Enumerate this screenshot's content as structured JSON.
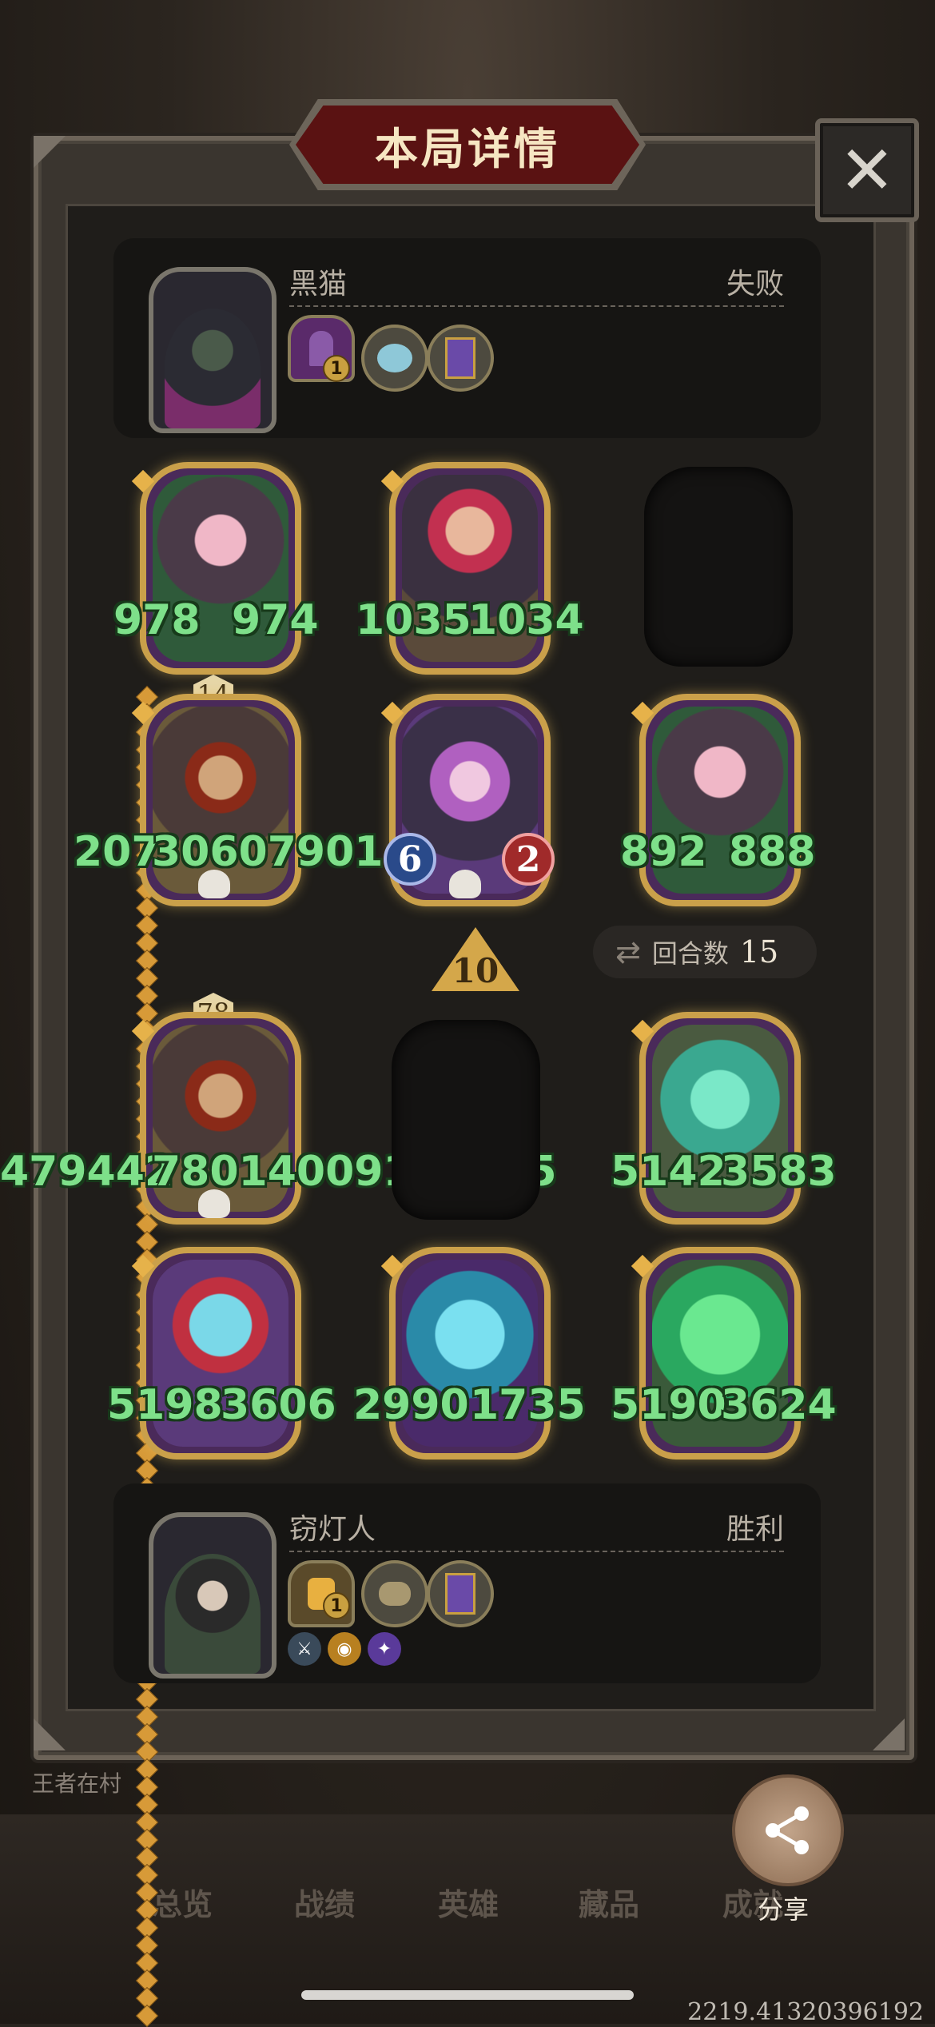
{
  "header": {
    "title": "本局详情",
    "close_icon": "close-icon"
  },
  "opponent": {
    "name": "黑猫",
    "result": "失败",
    "items": [
      {
        "icon": "purple-door-icon",
        "badge": "1"
      },
      {
        "icon": "fishbowl-icon"
      },
      {
        "icon": "scroll-icon"
      }
    ]
  },
  "opponent_board": [
    {
      "attack": "978",
      "health": "974"
    },
    {
      "attack": "1035",
      "health": "1034"
    },
    null
  ],
  "player_board_top": [
    {
      "attack": "207",
      "health": "30607901",
      "level": "14",
      "dead": true
    },
    {
      "attack": "6",
      "health": "2",
      "dead": true,
      "chip": true
    },
    {
      "attack": "892",
      "health": "888"
    }
  ],
  "tier": "10",
  "turns": {
    "label": "回合数",
    "value": "15"
  },
  "player_board_mid": [
    {
      "attack": "479442",
      "health": "78014009102375",
      "level": "78",
      "dead": true
    },
    null,
    {
      "attack": "5142",
      "health": "3583"
    }
  ],
  "player_board_bottom": [
    {
      "attack": "5198",
      "health": "3606"
    },
    {
      "attack": "2990",
      "health": "1735"
    },
    {
      "attack": "5190",
      "health": "3624"
    }
  ],
  "player": {
    "name": "窃灯人",
    "result": "胜利",
    "items": [
      {
        "icon": "lamp-icon",
        "badge": "1"
      },
      {
        "icon": "hand-icon"
      },
      {
        "icon": "scroll-icon"
      }
    ],
    "buffs": [
      "sword-buff-icon",
      "coin-buff-icon",
      "skull-buff-icon"
    ]
  },
  "bottom_nav": [
    "总览",
    "战绩",
    "英雄",
    "藏品",
    "成就"
  ],
  "share": {
    "label": "分享"
  },
  "background_text": "王者在村",
  "debug": "2219.41320396192",
  "colors": {
    "accent_gold": "#caa04a",
    "stat_green": "#7ee08a",
    "banner_red": "#5a1212"
  }
}
